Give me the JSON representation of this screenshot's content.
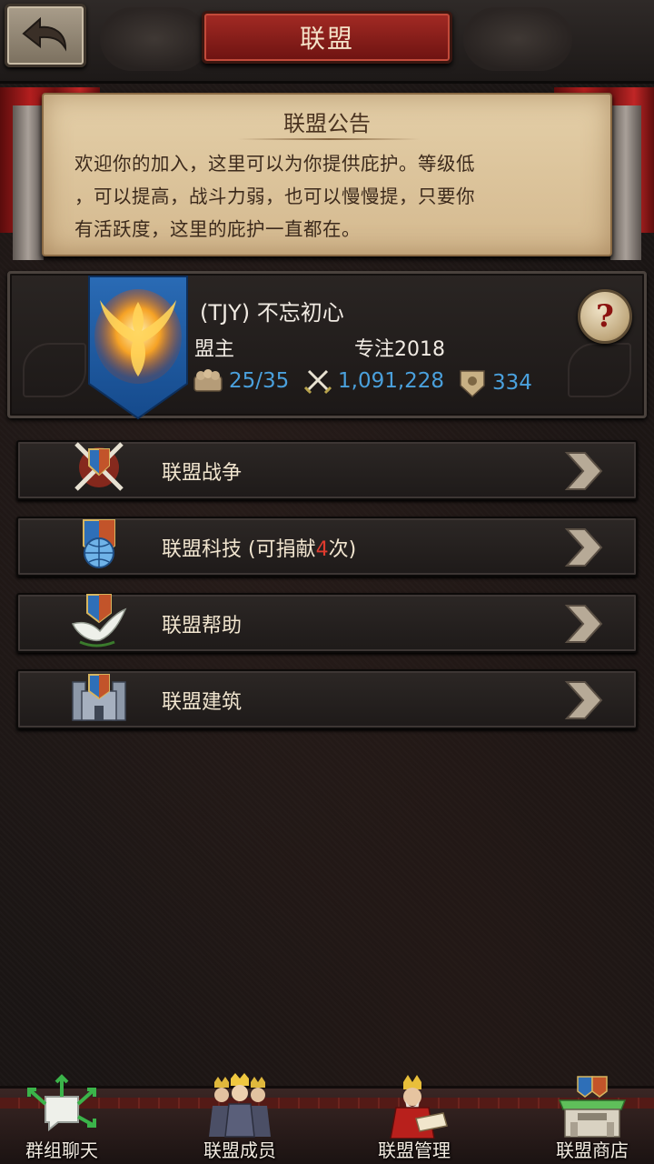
{
  "header": {
    "title": "联盟",
    "back_icon": "back-arrow-icon"
  },
  "notice": {
    "title": "联盟公告",
    "lines": [
      "欢迎你的加入，这里可以为你提供庇护。等级低",
      "，可以提高，战斗力弱，也可以慢慢提，只要你",
      "有活跃度，这里的庇护一直都在。"
    ]
  },
  "alliance": {
    "name": "(TJY) 不忘初心",
    "role_label": "盟主",
    "leader": "专注2018",
    "members": "25/35",
    "power": "1,091,228",
    "honor": "334",
    "help_label": "?",
    "banner_icon": "phoenix-banner-icon"
  },
  "menu": [
    {
      "label": "联盟战争",
      "icon": "crossed-swords-shield-icon"
    },
    {
      "label_prefix": "联盟科技 (可捐献",
      "label_count": "4",
      "label_suffix": "次)",
      "icon": "globe-shield-icon"
    },
    {
      "label": "联盟帮助",
      "icon": "dove-shield-icon"
    },
    {
      "label": "联盟建筑",
      "icon": "castle-shield-icon"
    }
  ],
  "nav": [
    {
      "label": "群组聊天",
      "icon": "chat-arrows-icon"
    },
    {
      "label": "联盟成员",
      "icon": "kings-group-icon"
    },
    {
      "label": "联盟管理",
      "icon": "king-reading-icon"
    },
    {
      "label": "联盟商店",
      "icon": "store-building-icon"
    }
  ],
  "colors": {
    "accent_blue": "#4aa0dc",
    "title_red": "#a32a24",
    "highlight_red": "#e03b2e",
    "parchment": "#e4cfa8"
  }
}
